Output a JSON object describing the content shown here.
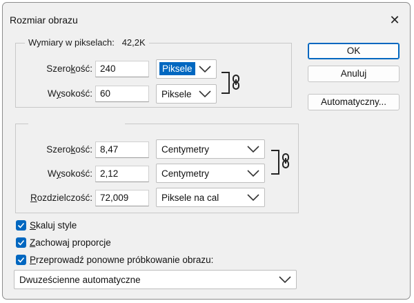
{
  "dialog": {
    "title": "Rozmiar obrazu",
    "close_glyph": "✕"
  },
  "pixel_dims": {
    "legend": "Wymiary w pikselach:",
    "size": "42,2K",
    "width": {
      "label_pre": "Szero",
      "label_key": "k",
      "label_post": "ość:",
      "value": "240",
      "unit": "Piksele"
    },
    "height": {
      "label_pre": "W",
      "label_key": "y",
      "label_post": "sokość:",
      "value": "60",
      "unit": "Piksele"
    },
    "link_icon": "chain-link-icon"
  },
  "doc_size": {
    "width": {
      "label_pre": "Szero",
      "label_key": "k",
      "label_post": "ość:",
      "value": "8,47",
      "unit": "Centymetry"
    },
    "height": {
      "label_pre": "W",
      "label_key": "y",
      "label_post": "sokość:",
      "value": "2,12",
      "unit": "Centymetry"
    },
    "resolution": {
      "label_pre": "",
      "label_key": "R",
      "label_post": "ozdzielczość:",
      "value": "72,009",
      "unit": "Piksele na cal"
    },
    "link_icon": "chain-link-icon"
  },
  "buttons": {
    "ok": "OK",
    "cancel": "Anuluj",
    "auto": "Automatyczny..."
  },
  "options": {
    "scale_styles": {
      "key": "S",
      "rest": "kaluj style",
      "checked": true
    },
    "constrain": {
      "key": "Z",
      "rest": "achowaj proporcje",
      "checked": true
    },
    "resample": {
      "key": "P",
      "rest": "rzeprowadź ponowne próbkowanie obrazu:",
      "checked": true
    },
    "resample_method": "Dwuześcienne automatyczne"
  },
  "colors": {
    "accent": "#0067c0",
    "dialog_bg": "#f0f0f0"
  }
}
